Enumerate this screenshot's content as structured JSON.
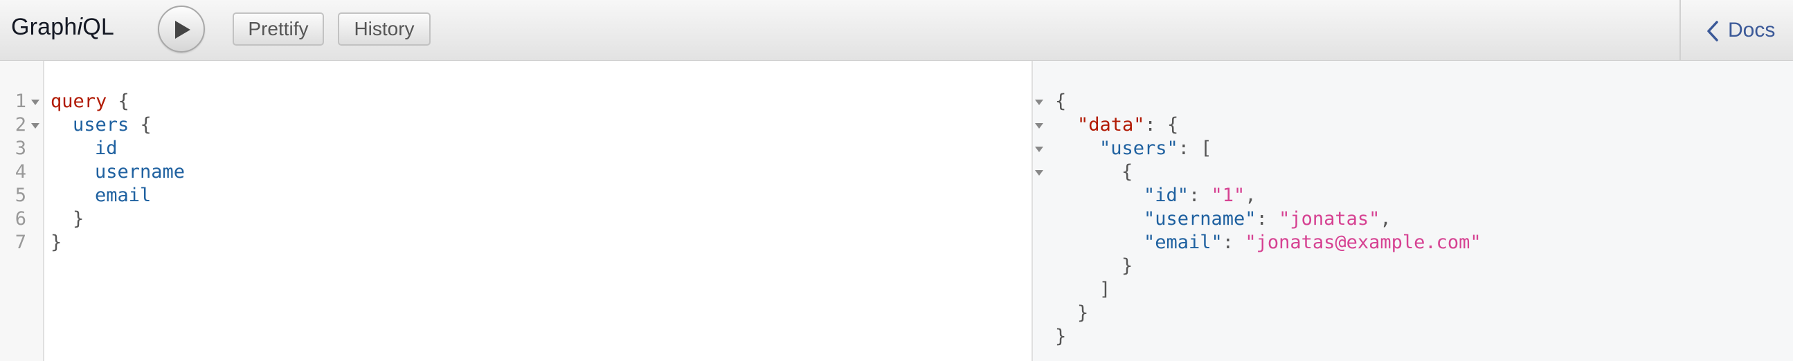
{
  "app": {
    "title_prefix": "Graph",
    "title_italic": "i",
    "title_suffix": "QL"
  },
  "toolbar": {
    "execute_icon": "play-icon",
    "prettify_label": "Prettify",
    "history_label": "History"
  },
  "docs": {
    "icon": "chevron-left-icon",
    "label": "Docs"
  },
  "query_editor": {
    "line_numbers": [
      "1",
      "2",
      "3",
      "4",
      "5",
      "6",
      "7"
    ],
    "lines": [
      {
        "keyword": "query",
        "punct": " {"
      },
      {
        "field": "users",
        "punct": " {"
      },
      {
        "field": "id"
      },
      {
        "field": "username"
      },
      {
        "field": "email"
      },
      {
        "punct": "}"
      },
      {
        "punct": "}"
      }
    ]
  },
  "result": {
    "open": "{",
    "data_key": "\"data\"",
    "data_punct": ": {",
    "users_key": "\"users\"",
    "users_punct": ": [",
    "obj_open": "{",
    "fields": [
      {
        "key": "\"id\"",
        "sep": ": ",
        "value": "\"1\"",
        "tail": ","
      },
      {
        "key": "\"username\"",
        "sep": ": ",
        "value": "\"jonatas\"",
        "tail": ","
      },
      {
        "key": "\"email\"",
        "sep": ": ",
        "value": "\"jonatas@example.com\"",
        "tail": ""
      }
    ],
    "obj_close": "}",
    "arr_close": "]",
    "data_close": "}",
    "close": "}"
  },
  "colors": {
    "keyword": "#b11a04",
    "field": "#1f61a0",
    "string": "#d64292",
    "docs_link": "#3b5998"
  }
}
